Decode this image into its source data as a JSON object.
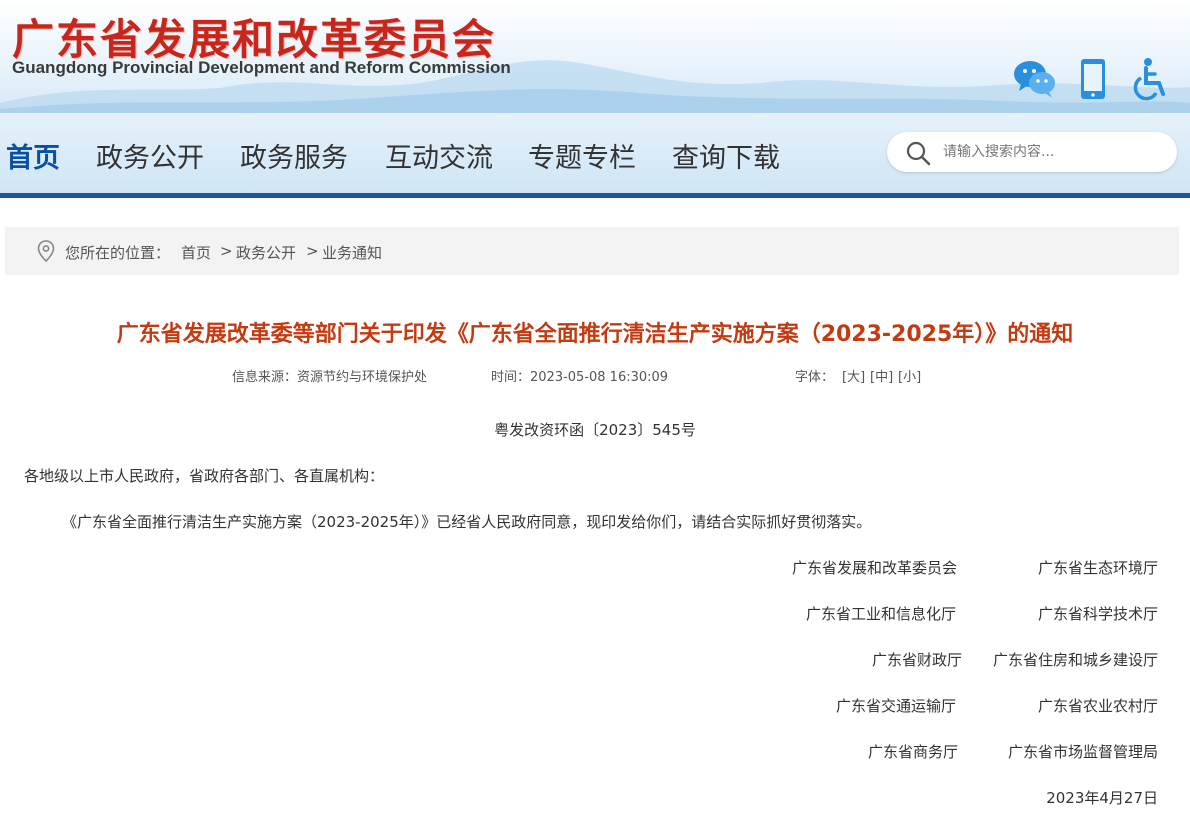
{
  "header": {
    "site_name": "广东省发展和改革委员会",
    "site_name_en": "Guangdong Provincial Development and Reform Commission",
    "icons": [
      "wechat-icon",
      "mobile-icon",
      "accessibility-icon"
    ]
  },
  "nav": {
    "items": [
      "首页",
      "政务公开",
      "政务服务",
      "互动交流",
      "专题专栏",
      "查询下载"
    ],
    "search_placeholder": "请输入搜索内容..."
  },
  "breadcrumb": {
    "prefix": "您所在的位置：",
    "items": [
      "首页",
      "政务公开",
      "业务通知"
    ],
    "separator": ">"
  },
  "article": {
    "title": "广东省发展改革委等部门关于印发《广东省全面推行清洁生产实施方案（2023-2025年）》的通知",
    "source": "信息来源：资源节约与环境保护处",
    "time": "时间：2023-05-08 16:30:09",
    "font_label": "字体：",
    "font_options": [
      "[大]",
      "[中]",
      "[小]"
    ],
    "doc_number": "粤发改资环函〔2023〕545号",
    "salutation": "各地级以上市人民政府，省政府各部门、各直属机构：",
    "body": "《广东省全面推行清洁生产实施方案（2023-2025年）》已经省人民政府同意，现印发给你们，请结合实际抓好贯彻落实。",
    "signatories": [
      [
        "广东省发展和改革委员会",
        "广东省生态环境厅"
      ],
      [
        "广东省工业和信息化厅",
        "广东省科学技术厅"
      ],
      [
        "广东省财政厅",
        "广东省住房和城乡建设厅"
      ],
      [
        "广东省交通运输厅",
        "广东省农业农村厅"
      ],
      [
        "广东省商务厅",
        "广东省市场监督管理局"
      ]
    ],
    "date": "2023年4月27日"
  },
  "colors": {
    "brand_red": "#c8261c",
    "title_red": "#c43b12",
    "nav_active": "#0a4fa6",
    "nav_border": "#1e5799"
  }
}
